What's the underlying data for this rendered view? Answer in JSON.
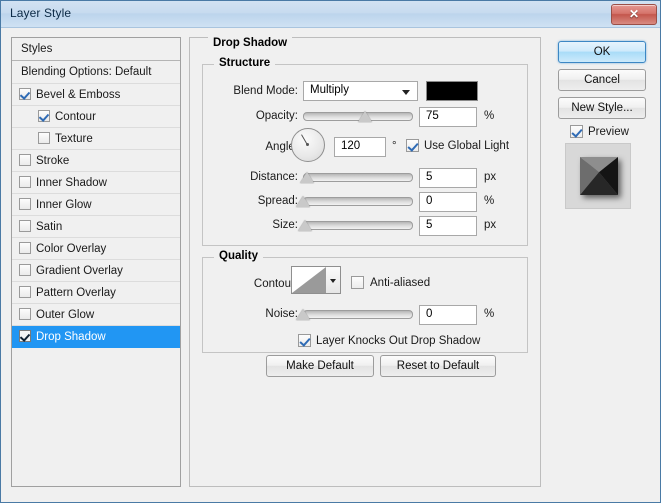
{
  "window": {
    "title": "Layer Style",
    "close_label": "✕"
  },
  "sidebar": {
    "header": "Styles",
    "blending_options": "Blending Options: Default",
    "items": [
      {
        "label": "Bevel & Emboss",
        "checked": true,
        "indent": 0,
        "selected": false
      },
      {
        "label": "Contour",
        "checked": true,
        "indent": 1,
        "selected": false
      },
      {
        "label": "Texture",
        "checked": false,
        "indent": 1,
        "selected": false
      },
      {
        "label": "Stroke",
        "checked": false,
        "indent": 0,
        "selected": false
      },
      {
        "label": "Inner Shadow",
        "checked": false,
        "indent": 0,
        "selected": false
      },
      {
        "label": "Inner Glow",
        "checked": false,
        "indent": 0,
        "selected": false
      },
      {
        "label": "Satin",
        "checked": false,
        "indent": 0,
        "selected": false
      },
      {
        "label": "Color Overlay",
        "checked": false,
        "indent": 0,
        "selected": false
      },
      {
        "label": "Gradient Overlay",
        "checked": false,
        "indent": 0,
        "selected": false
      },
      {
        "label": "Pattern Overlay",
        "checked": false,
        "indent": 0,
        "selected": false
      },
      {
        "label": "Outer Glow",
        "checked": false,
        "indent": 0,
        "selected": false
      },
      {
        "label": "Drop Shadow",
        "checked": true,
        "indent": 0,
        "selected": true
      }
    ]
  },
  "main": {
    "panel_title": "Drop Shadow",
    "structure": {
      "title": "Structure",
      "blend_mode_label": "Blend Mode:",
      "blend_mode_value": "Multiply",
      "color_swatch": "#000000",
      "opacity_label": "Opacity:",
      "opacity_value": "75",
      "opacity_unit": "%",
      "angle_label": "Angle:",
      "angle_value": "120",
      "angle_unit": "°",
      "use_global_light_label": "Use Global Light",
      "use_global_light_checked": true,
      "distance_label": "Distance:",
      "distance_value": "5",
      "distance_unit": "px",
      "spread_label": "Spread:",
      "spread_value": "0",
      "spread_unit": "%",
      "size_label": "Size:",
      "size_value": "5",
      "size_unit": "px"
    },
    "quality": {
      "title": "Quality",
      "contour_label": "Contour:",
      "anti_aliased_label": "Anti-aliased",
      "anti_aliased_checked": false,
      "noise_label": "Noise:",
      "noise_value": "0",
      "noise_unit": "%"
    },
    "knockout_label": "Layer Knocks Out Drop Shadow",
    "knockout_checked": true,
    "make_default_label": "Make Default",
    "reset_default_label": "Reset to Default"
  },
  "right": {
    "ok_label": "OK",
    "cancel_label": "Cancel",
    "new_style_label": "New Style...",
    "preview_label": "Preview",
    "preview_checked": true,
    "accent_color": "#2196f3"
  }
}
